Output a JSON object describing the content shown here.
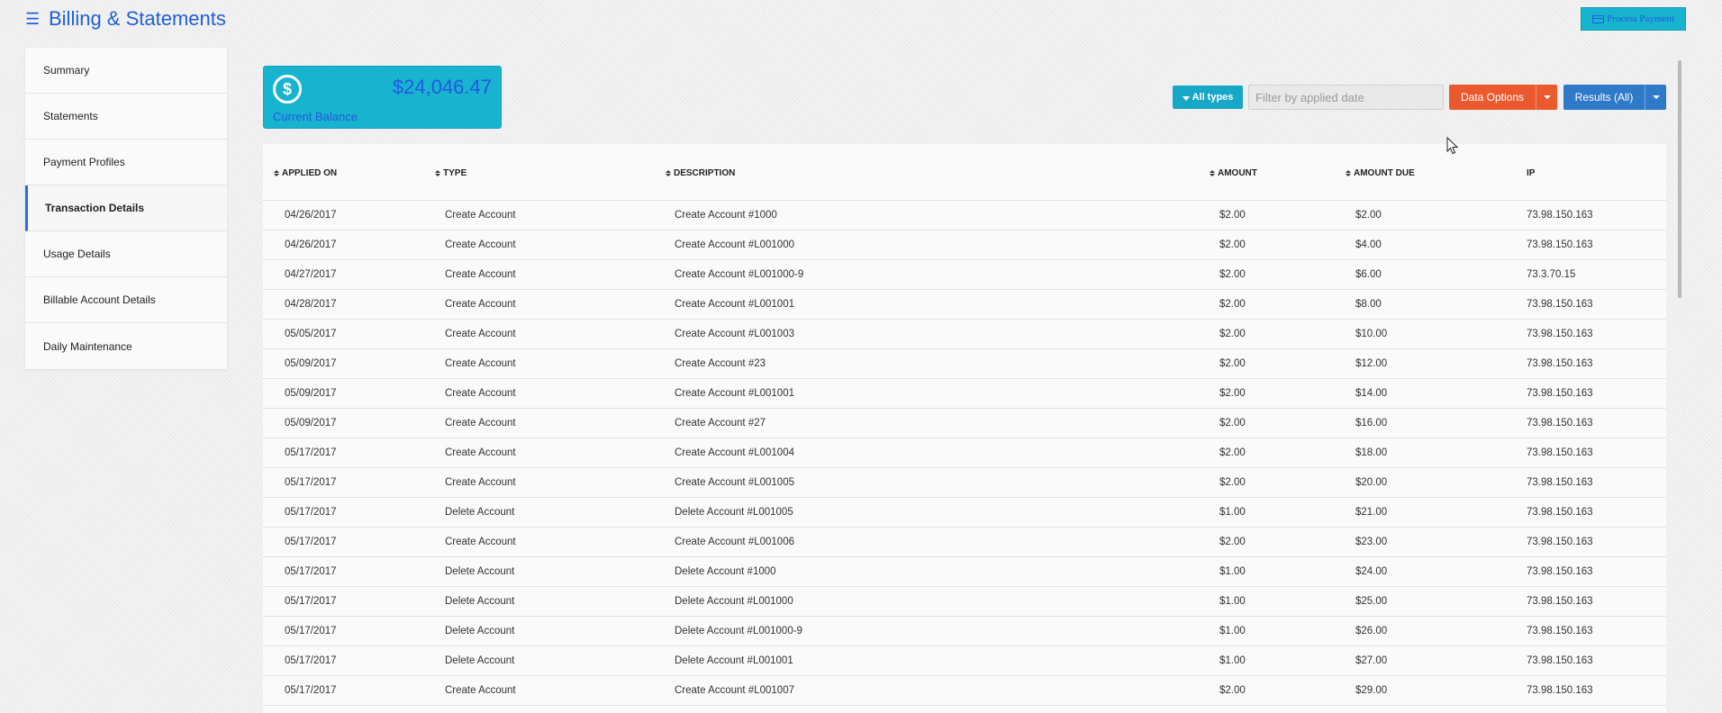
{
  "header": {
    "title": "Billing & Statements",
    "menu_icon": "hamburger-menu-icon",
    "process_payment_label": "Process Payment"
  },
  "sidebar": {
    "items": [
      {
        "label": "Summary",
        "active": false
      },
      {
        "label": "Statements",
        "active": false
      },
      {
        "label": "Payment Profiles",
        "active": false
      },
      {
        "label": "Transaction Details",
        "active": true
      },
      {
        "label": "Usage Details",
        "active": false
      },
      {
        "label": "Billable Account Details",
        "active": false
      },
      {
        "label": "Daily Maintenance",
        "active": false
      }
    ]
  },
  "balance": {
    "amount": "$24,046.47",
    "label": "Current Balance",
    "icon": "dollar-icon"
  },
  "toolbar": {
    "types_label": "All types",
    "filter_placeholder": "Filter by applied date",
    "filter_value": "",
    "data_options_label": "Data Options",
    "results_label": "Results (All)"
  },
  "table": {
    "columns": [
      "APPLIED ON",
      "TYPE",
      "DESCRIPTION",
      "AMOUNT",
      "AMOUNT DUE",
      "IP"
    ],
    "rows": [
      [
        "04/26/2017",
        "Create Account",
        "Create Account #1000",
        "$2.00",
        "$2.00",
        "73.98.150.163"
      ],
      [
        "04/26/2017",
        "Create Account",
        "Create Account #L001000",
        "$2.00",
        "$4.00",
        "73.98.150.163"
      ],
      [
        "04/27/2017",
        "Create Account",
        "Create Account #L001000-9",
        "$2.00",
        "$6.00",
        "73.3.70.15"
      ],
      [
        "04/28/2017",
        "Create Account",
        "Create Account #L001001",
        "$2.00",
        "$8.00",
        "73.98.150.163"
      ],
      [
        "05/05/2017",
        "Create Account",
        "Create Account #L001003",
        "$2.00",
        "$10.00",
        "73.98.150.163"
      ],
      [
        "05/09/2017",
        "Create Account",
        "Create Account #23",
        "$2.00",
        "$12.00",
        "73.98.150.163"
      ],
      [
        "05/09/2017",
        "Create Account",
        "Create Account #L001001",
        "$2.00",
        "$14.00",
        "73.98.150.163"
      ],
      [
        "05/09/2017",
        "Create Account",
        "Create Account #27",
        "$2.00",
        "$16.00",
        "73.98.150.163"
      ],
      [
        "05/17/2017",
        "Create Account",
        "Create Account #L001004",
        "$2.00",
        "$18.00",
        "73.98.150.163"
      ],
      [
        "05/17/2017",
        "Create Account",
        "Create Account #L001005",
        "$2.00",
        "$20.00",
        "73.98.150.163"
      ],
      [
        "05/17/2017",
        "Delete Account",
        "Delete Account #L001005",
        "$1.00",
        "$21.00",
        "73.98.150.163"
      ],
      [
        "05/17/2017",
        "Create Account",
        "Create Account #L001006",
        "$2.00",
        "$23.00",
        "73.98.150.163"
      ],
      [
        "05/17/2017",
        "Delete Account",
        "Delete Account #1000",
        "$1.00",
        "$24.00",
        "73.98.150.163"
      ],
      [
        "05/17/2017",
        "Delete Account",
        "Delete Account #L001000",
        "$1.00",
        "$25.00",
        "73.98.150.163"
      ],
      [
        "05/17/2017",
        "Delete Account",
        "Delete Account #L001000-9",
        "$1.00",
        "$26.00",
        "73.98.150.163"
      ],
      [
        "05/17/2017",
        "Delete Account",
        "Delete Account #L001001",
        "$1.00",
        "$27.00",
        "73.98.150.163"
      ],
      [
        "05/17/2017",
        "Create Account",
        "Create Account #L001007",
        "$2.00",
        "$29.00",
        "73.98.150.163"
      ]
    ]
  },
  "colors": {
    "title_blue": "#1f5fd6",
    "cyan": "#18b3cf",
    "orange": "#ea5a2e",
    "blue_button": "#2f7ac8",
    "active_border": "#2a6fdb"
  }
}
